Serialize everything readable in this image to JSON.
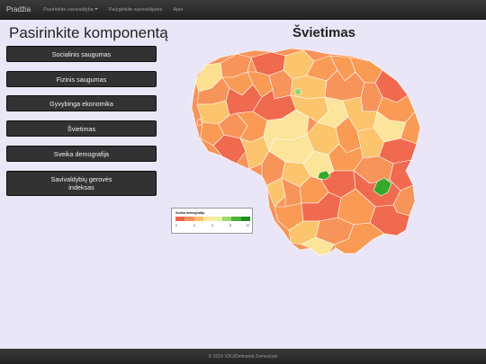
{
  "navbar": {
    "brand": "Pradžia",
    "items": [
      {
        "label": "Pasirinkite savivaldybę"
      },
      {
        "label": "Palyginkite savivaldybes"
      },
      {
        "label": "Apie"
      }
    ]
  },
  "sidebar": {
    "title": "Pasirinkite komponentą",
    "buttons": [
      {
        "label": "Socialinis saugumas"
      },
      {
        "label": "Fizinis saugumas"
      },
      {
        "label": "Gyvybinga ekonomika"
      },
      {
        "label": "Švietimas"
      },
      {
        "label": "Sveika demografija"
      },
      {
        "label_line1": "Savivaldybių gerovės",
        "label_line2": "indeksas"
      }
    ]
  },
  "map": {
    "title": "Švietimas",
    "colors": {
      "low": "#ef6a4e",
      "mid_low": "#f99a55",
      "mid": "#fcc46c",
      "mid_high": "#fce49a",
      "high": "#8fd46b",
      "top": "#37a82a",
      "border": "#ffffff"
    }
  },
  "legend": {
    "title": "Sveika demografija",
    "colors": [
      "#f0644a",
      "#f8905a",
      "#fcc06a",
      "#fde898",
      "#e8f2a0",
      "#9fd66e",
      "#4bb23a",
      "#1f8f1c"
    ],
    "ticks": [
      "0",
      "4",
      "6",
      "8",
      "10"
    ]
  },
  "footer": {
    "text": "© 2019 VDU/Deimantė Zemeckytė"
  }
}
